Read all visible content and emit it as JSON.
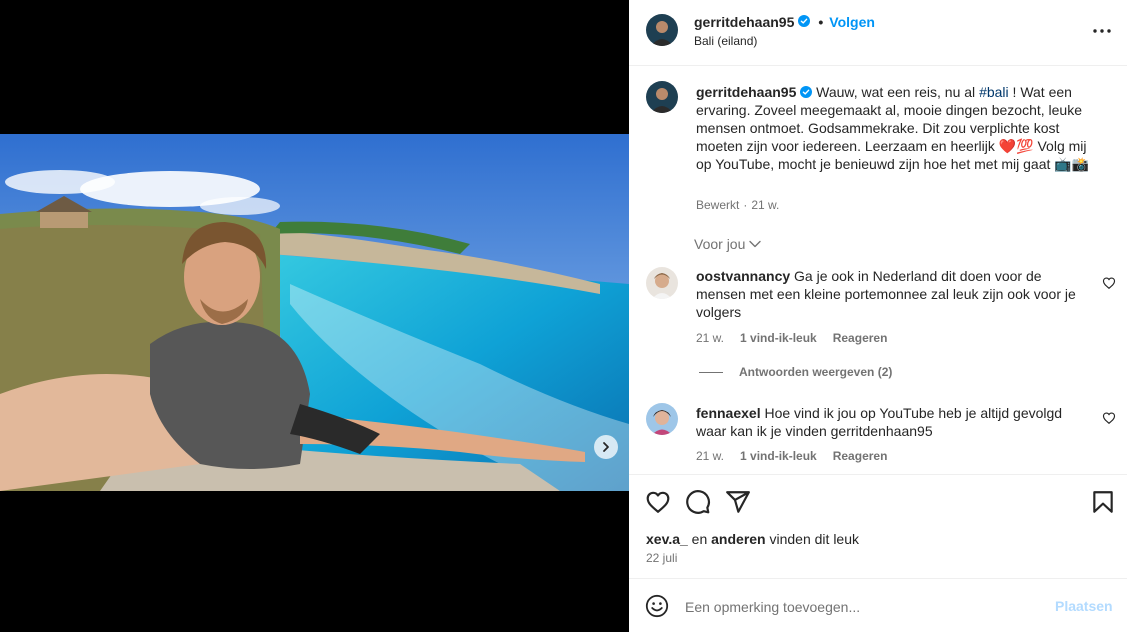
{
  "post": {
    "images_count": 7,
    "active_image_index": 0
  },
  "header": {
    "username": "gerritdehaan95",
    "separator": "•",
    "follow_label": "Volgen",
    "location": "Bali (eiland)"
  },
  "caption": {
    "username": "gerritdehaan95",
    "text_before_tag": "Wauw, wat een reis, nu al ",
    "hashtag": "#bali",
    "text_after_tag": " ! Wat een ervaring. Zoveel meegemaakt al, mooie dingen bezocht, leuke mensen ontmoet. Godsammekrake. Dit zou verplichte kost moeten zijn voor iedereen. Leerzaam en heerlijk ❤️💯 Volg mij op YouTube, mocht je benieuwd zijn hoe het met mij gaat 📺📸",
    "edited_label": "Bewerkt",
    "separator": "·",
    "time": "21 w."
  },
  "filter": {
    "label": "Voor jou"
  },
  "comments": [
    {
      "username": "oostvannancy",
      "text": "Ga je ook in Nederland dit doen voor de mensen met een kleine portemonnee zal leuk zijn ook voor je volgers",
      "time": "21 w.",
      "likes": "1 vind-ik-leuk",
      "reply_label": "Reageren",
      "view_replies": "Antwoorden weergeven (2)"
    },
    {
      "username": "fennaexel",
      "text": "Hoe vind ik jou op YouTube heb je altijd gevolgd waar kan ik je vinden gerritdenhaan95",
      "time": "21 w.",
      "likes": "1 vind-ik-leuk",
      "reply_label": "Reageren"
    }
  ],
  "engagement": {
    "liked_by_user": "xev.a_",
    "liked_by_connector": "en",
    "liked_by_others": "anderen",
    "liked_by_suffix": "vinden dit leuk",
    "date": "22 juli"
  },
  "add_comment": {
    "placeholder": "Een opmerking toevoegen...",
    "post_label": "Plaatsen"
  },
  "icons": {
    "like": "heart-icon",
    "comment": "comment-icon",
    "share": "share-icon",
    "save": "bookmark-icon",
    "emoji": "emoji-icon",
    "more": "more-options-icon",
    "verified": "verified-badge-icon",
    "next": "chevron-right-icon"
  },
  "colors": {
    "accent": "#0095f6",
    "hashtag": "#00376b",
    "muted": "#737373",
    "post_disabled": "#b3dbff"
  }
}
